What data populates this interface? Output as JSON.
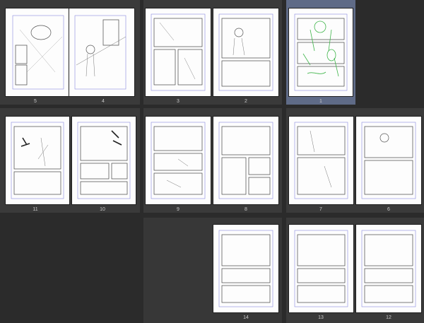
{
  "app": {
    "view": "page-manager"
  },
  "pages": [
    {
      "id": "p5",
      "label": "5"
    },
    {
      "id": "p4",
      "label": "4"
    },
    {
      "id": "p3",
      "label": "3"
    },
    {
      "id": "p2",
      "label": "2"
    },
    {
      "id": "p1",
      "label": "1",
      "selected": true,
      "sketch_color": "#3fb54a"
    },
    {
      "id": "p11",
      "label": "11"
    },
    {
      "id": "p10",
      "label": "10"
    },
    {
      "id": "p9",
      "label": "9"
    },
    {
      "id": "p8",
      "label": "8"
    },
    {
      "id": "p7",
      "label": "7"
    },
    {
      "id": "p6",
      "label": "6"
    },
    {
      "id": "p14",
      "label": "14"
    },
    {
      "id": "p13",
      "label": "13"
    },
    {
      "id": "p12",
      "label": "12"
    }
  ],
  "colors": {
    "background": "#2b2b2b",
    "spread": "#3a3a3a",
    "selected_spread": "#5f6b87",
    "guide": "#6f66c9",
    "sketch": "#555555"
  }
}
